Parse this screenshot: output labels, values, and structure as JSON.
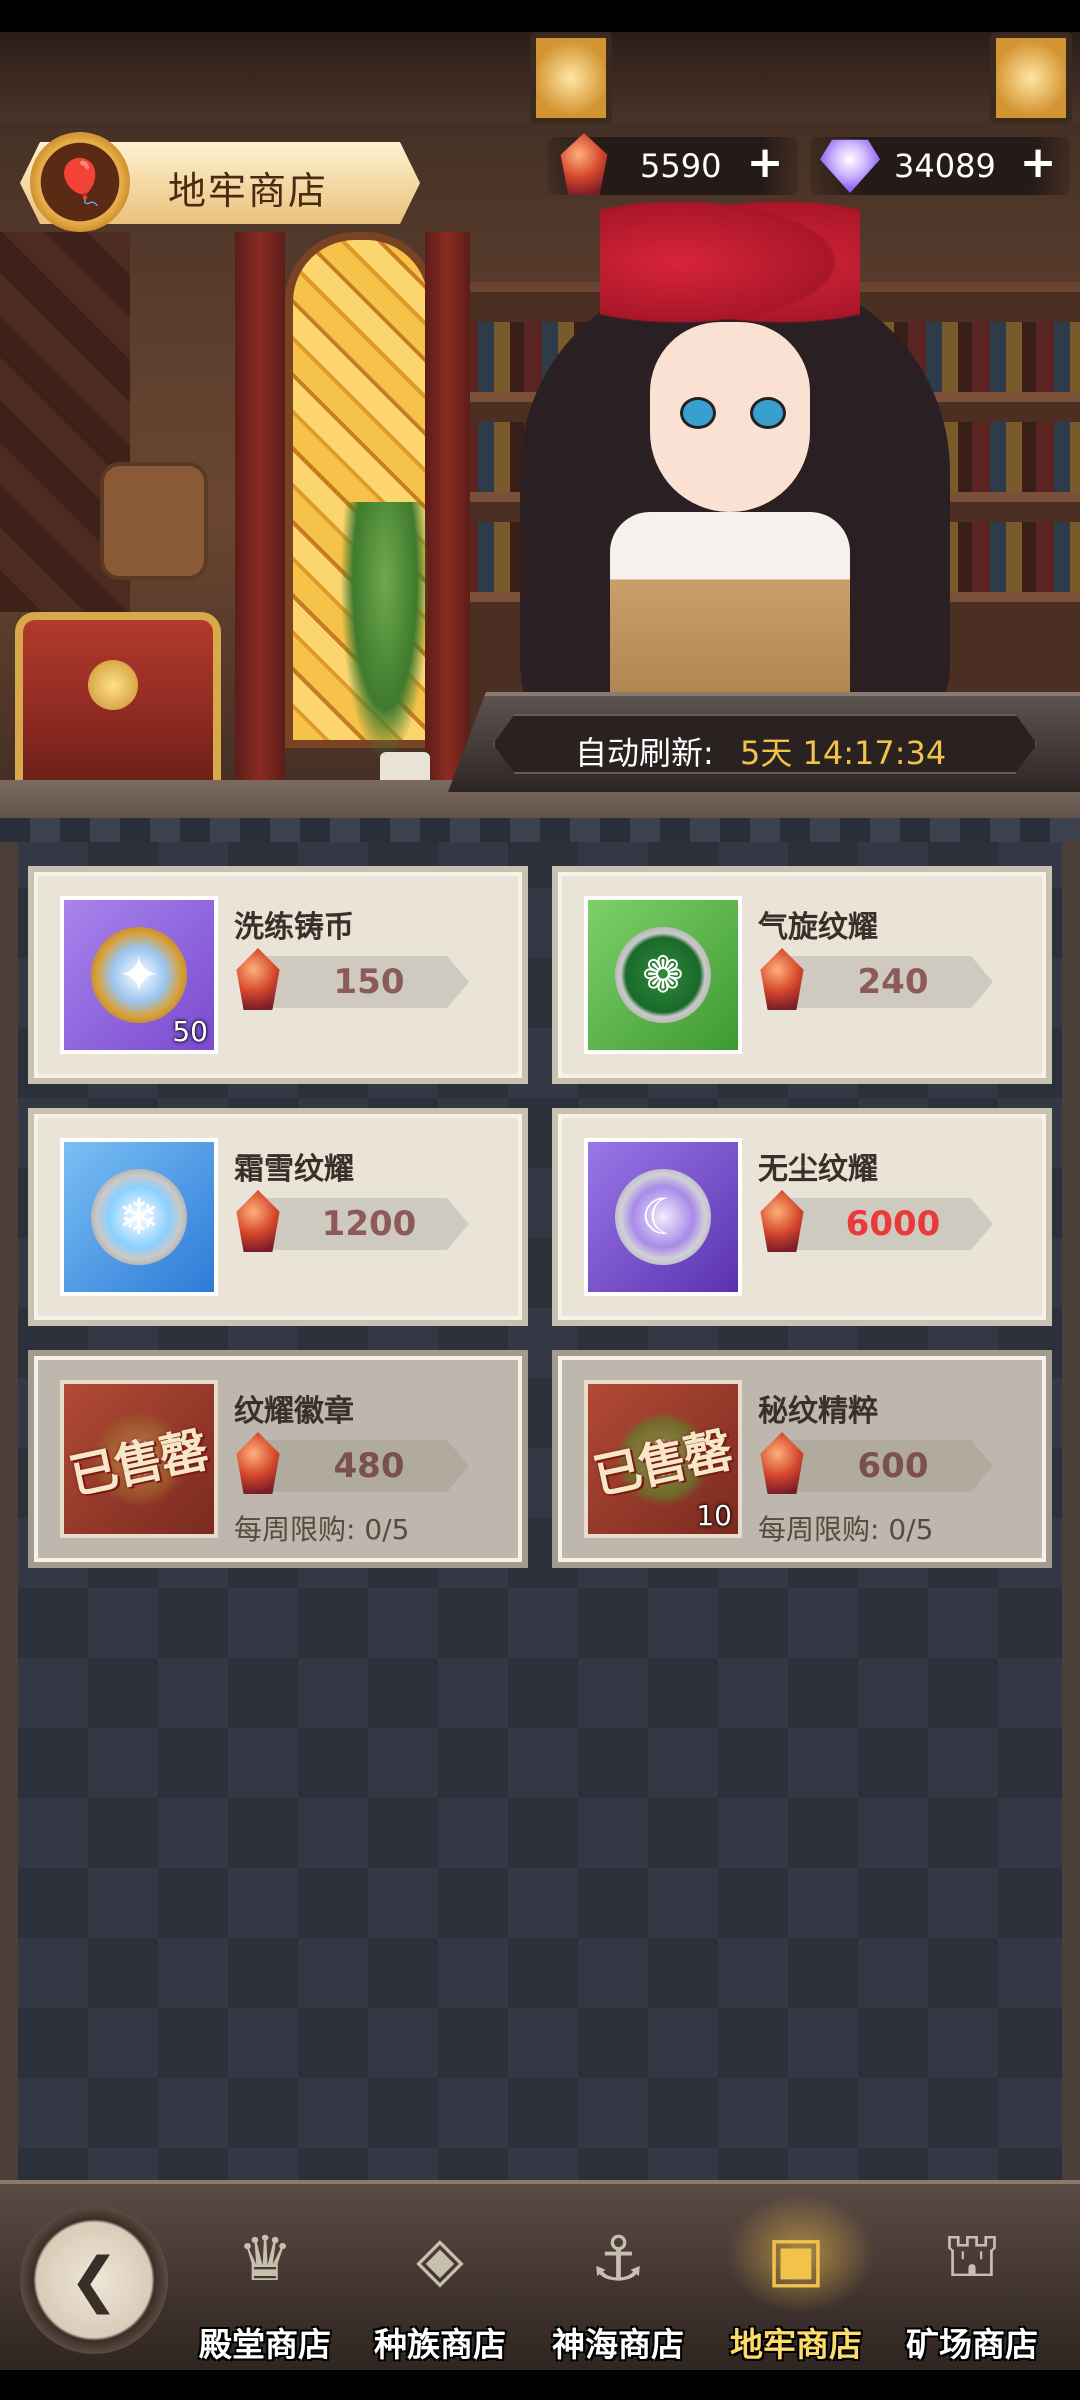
{
  "header": {
    "title": "地牢商店",
    "title_icon": "hot-air-balloon-icon"
  },
  "currencies": [
    {
      "name": "dungeon-coin",
      "icon": "red-gem-icon",
      "value": "5590"
    },
    {
      "name": "diamond",
      "icon": "purple-diamond-icon",
      "value": "34089"
    }
  ],
  "refresh": {
    "label": "自动刷新:",
    "time": "5天 14:17:34"
  },
  "items": [
    {
      "name": "洗练铸币",
      "price": "150",
      "count": "50",
      "color": "#8a5cd8",
      "icon": "star-coin-icon",
      "price_color": "normal",
      "sold": false
    },
    {
      "name": "气旋纹耀",
      "price": "240",
      "count": "",
      "color": "#4caa3a",
      "icon": "cyclone-emblem-icon",
      "price_color": "normal",
      "sold": false
    },
    {
      "name": "霜雪纹耀",
      "price": "1200",
      "count": "",
      "color": "#3a8ee0",
      "icon": "snowflake-emblem-icon",
      "price_color": "normal",
      "sold": false
    },
    {
      "name": "无尘纹耀",
      "price": "6000",
      "count": "",
      "color": "#7a4ad0",
      "icon": "moon-emblem-icon",
      "price_color": "red",
      "sold": false
    },
    {
      "name": "纹耀徽章",
      "price": "480",
      "count": "",
      "color": "#9a3a2a",
      "icon": "badge-icon",
      "price_color": "normal",
      "sold": true,
      "sold_label": "已售罄",
      "limit": "每周限购: 0/5"
    },
    {
      "name": "秘纹精粹",
      "price": "600",
      "count": "10",
      "color": "#9a3a2a",
      "icon": "essence-icon",
      "price_color": "normal",
      "sold": true,
      "sold_label": "已售罄",
      "limit": "每周限购: 0/5"
    }
  ],
  "nav": {
    "back_icon": "back-arrow-icon",
    "items": [
      {
        "label": "殿堂商店",
        "icon": "hall-shop-icon",
        "active": false
      },
      {
        "label": "种族商店",
        "icon": "race-shop-icon",
        "active": false
      },
      {
        "label": "神海商店",
        "icon": "sea-shop-icon",
        "active": false
      },
      {
        "label": "地牢商店",
        "icon": "dungeon-shop-icon",
        "active": true
      },
      {
        "label": "矿场商店",
        "icon": "mine-shop-icon",
        "active": false
      }
    ]
  }
}
